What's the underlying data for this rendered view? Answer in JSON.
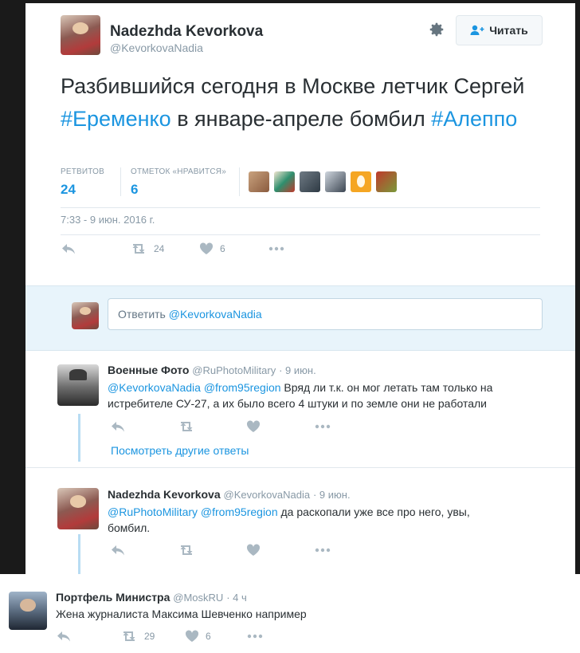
{
  "main_tweet": {
    "author_name": "Nadezhda Kevorkova",
    "author_handle": "@KevorkovaNadia",
    "follow_label": "Читать",
    "text_before": "Разбившийся сегодня в Москве летчик Сергей ",
    "hashtag1": "#Еременко",
    "text_middle": " в январе-апреле бомбил ",
    "hashtag2": "#Алеппо",
    "retweets_label": "РЕТВИТОВ",
    "retweets_count": "24",
    "likes_label": "ОТМЕТОК «НРАВИТСЯ»",
    "likes_count": "6",
    "timestamp": "7:33 - 9 июн. 2016 г.",
    "action_retweets": "24",
    "action_likes": "6"
  },
  "reply_compose": {
    "placeholder_prefix": "Ответить ",
    "placeholder_handle": "@KevorkovaNadia"
  },
  "reply1": {
    "author_name": "Военные Фото",
    "author_handle": "@RuPhotoMilitary",
    "date": "· 9 июн.",
    "mention1": "@KevorkovaNadia",
    "mention2": "@from95region",
    "text": " Вряд ли т.к. он мог летать там только на истребителе СУ-27, а их было всего 4 штуки и по земле они не работали",
    "more_replies": "Посмотреть другие ответы"
  },
  "reply2": {
    "author_name": "Nadezhda Kevorkova",
    "author_handle": "@KevorkovaNadia",
    "date": "· 9 июн.",
    "mention1": "@RuPhotoMilitary",
    "mention2": "@from95region",
    "text": " да раскопали уже все про него, увы, бомбил."
  },
  "outer_tweet": {
    "author_name": "Портфель Министра",
    "author_handle": "@MoskRU",
    "date": "· 4 ч",
    "text": "Жена журналиста Максима Шевченко например",
    "retweets": "29",
    "likes": "6"
  },
  "colors": {
    "accent": "#1b95e0",
    "muted": "#8899a6",
    "reply_bg": "#e8f4fb"
  }
}
